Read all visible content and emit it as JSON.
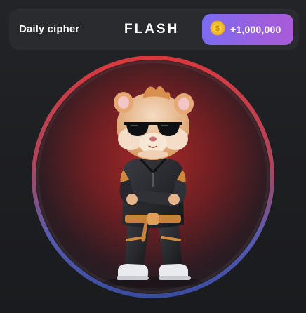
{
  "cipher": {
    "label": "Daily cipher",
    "word": "FLASH",
    "reward": "+1,000,000"
  },
  "icons": {
    "coin": "coin-icon",
    "character": "hamster-character"
  },
  "colors": {
    "background": "#1e1f22",
    "bar_background": "#2a2b2f",
    "badge_gradient_start": "#7a6cf2",
    "badge_gradient_end": "#a95bd8",
    "coin": "#f3c32c",
    "ring_top": "#e0393d",
    "ring_bottom": "#4a62c9",
    "glow": "#8a2326"
  }
}
